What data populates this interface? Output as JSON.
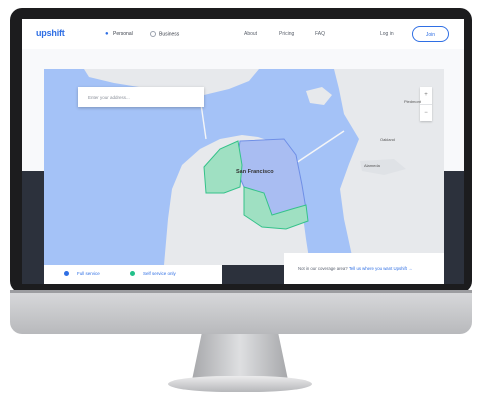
{
  "colors": {
    "brand": "#2f6fe4",
    "water": "#a4c2f7",
    "land": "#e7e9ec",
    "full_service": "#2f6fe4",
    "self_service": "#22c08a"
  },
  "nav": {
    "logo": "upshift",
    "tabs": [
      {
        "label": "Personal",
        "icon": "person-icon"
      },
      {
        "label": "Business",
        "icon": "circle-icon"
      }
    ],
    "links": [
      "About",
      "Pricing",
      "FAQ"
    ],
    "login": "Log in",
    "join": "Join"
  },
  "map": {
    "search_placeholder": "Enter your address...",
    "city_label": "San Francisco",
    "place_labels": [
      "Oakland",
      "Alameda",
      "Piedmont"
    ],
    "zoom_in": "+",
    "zoom_out": "−"
  },
  "legend": {
    "full_service": "Full service",
    "self_service": "Self service only"
  },
  "coverage": {
    "question": "Not in our coverage area?",
    "link": "Tell us where you want Upshift →"
  }
}
